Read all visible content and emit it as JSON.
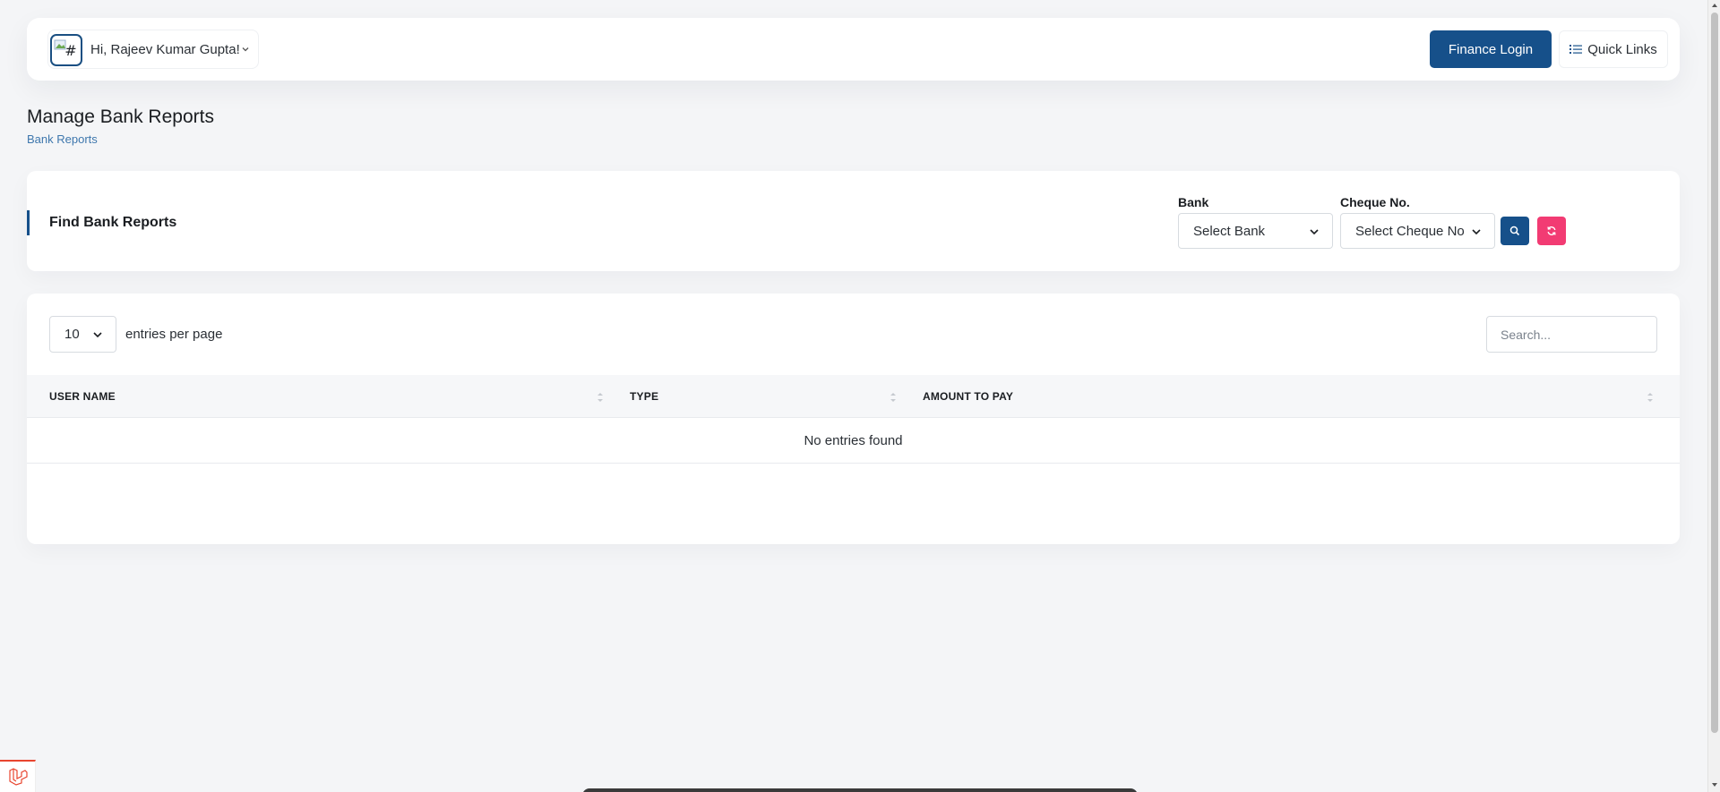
{
  "header": {
    "greeting": "Hi, Rajeev Kumar Gupta!",
    "avatar_alt": "#",
    "finance_login_label": "Finance Login",
    "quick_links_label": "Quick Links"
  },
  "page": {
    "title": "Manage Bank Reports",
    "breadcrumb": "Bank Reports"
  },
  "filter": {
    "title": "Find Bank Reports",
    "bank_label": "Bank",
    "bank_value": "Select Bank",
    "cheque_label": "Cheque No.",
    "cheque_value": "Select Cheque No"
  },
  "table": {
    "per_page_value": "10",
    "per_page_label": "entries per page",
    "search_placeholder": "Search...",
    "columns": [
      "USER NAME",
      "TYPE",
      "AMOUNT TO PAY"
    ],
    "empty_message": "No entries found"
  },
  "colors": {
    "primary": "#16508a",
    "danger": "#f23b73",
    "link": "#3e77ad"
  },
  "icons": {
    "search": "search-icon",
    "reset": "refresh-icon",
    "quick_links": "list-icon",
    "dropdown": "chevron-down-icon",
    "sort": "sort-icon",
    "laravel": "laravel-icon"
  }
}
